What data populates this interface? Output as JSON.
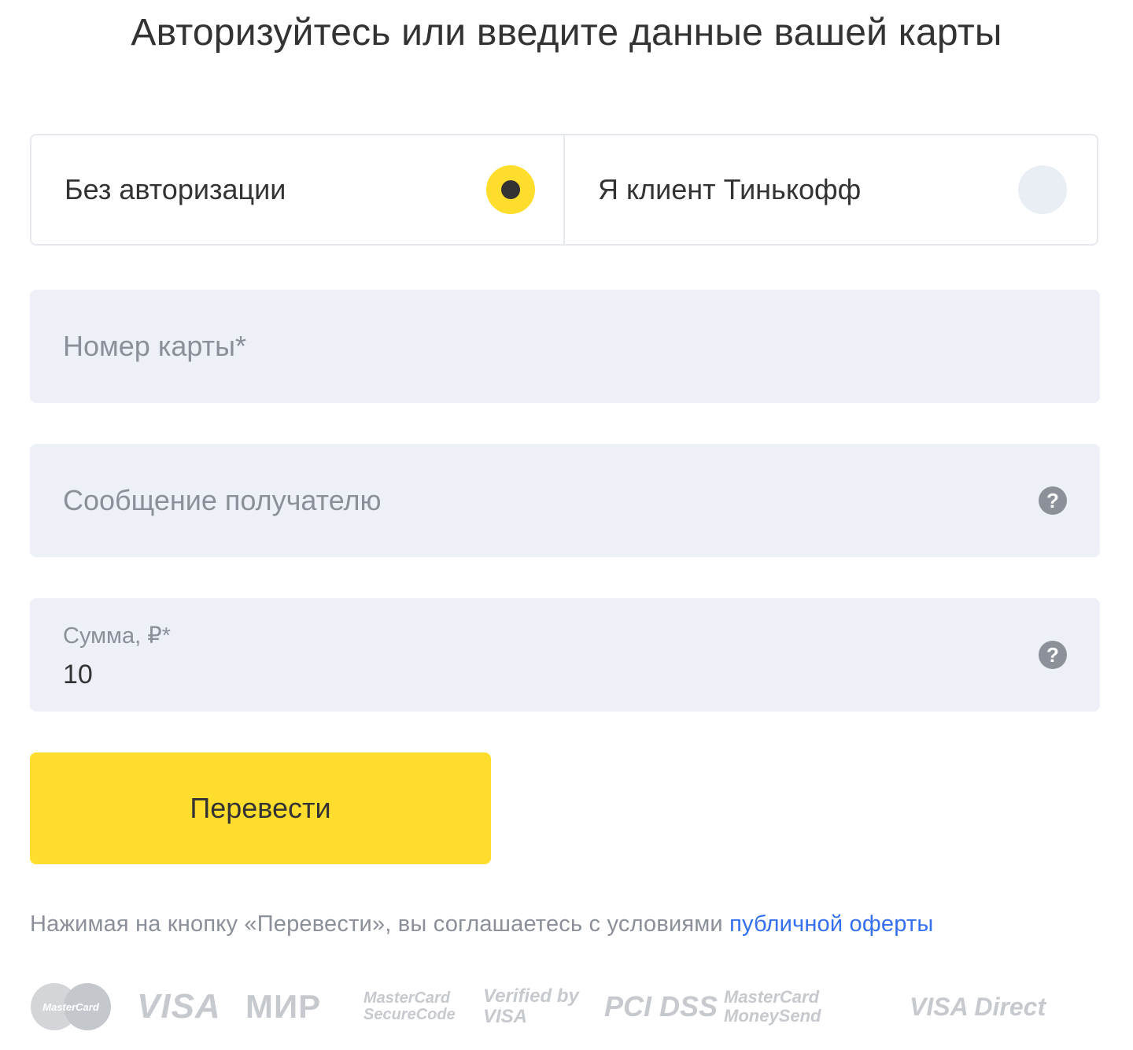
{
  "header": {
    "title": "Авторизуйтесь или введите данные вашей карты"
  },
  "auth_toggle": {
    "options": [
      {
        "label": "Без авторизации",
        "selected": true
      },
      {
        "label": "Я клиент Тинькофф",
        "selected": false
      }
    ]
  },
  "form": {
    "card_number": {
      "placeholder": "Номер карты*",
      "value": ""
    },
    "message": {
      "placeholder": "Сообщение получателю",
      "value": "",
      "help_icon": "question-circle-icon"
    },
    "amount": {
      "label": "Сумма, ₽*",
      "value": "10",
      "help_icon": "question-circle-icon"
    },
    "submit_label": "Перевести"
  },
  "agreement": {
    "text": "Нажимая на кнопку «Перевести», вы соглашаетесь с условиями ",
    "link_text": "публичной оферты"
  },
  "payment_logos": [
    "MasterCard",
    "VISA",
    "МИР",
    "MasterCard SecureCode",
    "Verified by VISA",
    "PCI DSS",
    "MasterCard MoneySend",
    "VISA Direct"
  ],
  "colors": {
    "accent_yellow": "#ffdd2d",
    "field_background": "#edf0f6",
    "link_blue": "#336fee",
    "text_dark": "#333333",
    "text_muted": "#8a8f99",
    "logo_gray": "#c6c9ce"
  }
}
